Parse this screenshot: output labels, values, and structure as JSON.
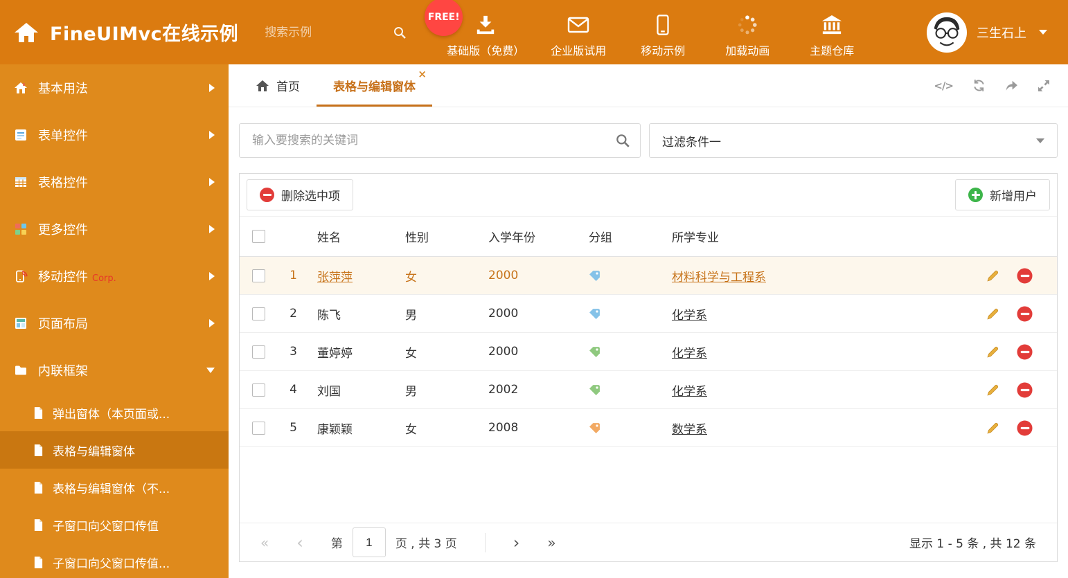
{
  "colors": {
    "header_bg": "#DB7B10",
    "sidebar_bg": "#DF8A1C",
    "sidebar_active_bg": "#C97711",
    "accent": "#C7711A",
    "free_badge_bg": "#FF4642",
    "corp_red": "#E8352A",
    "delete_red": "#E23C39",
    "add_green": "#3DB54A",
    "pencil_orange": "#E8B03C",
    "tag_blue": "#85C2E8",
    "tag_green": "#8FC97F",
    "tag_orange": "#F2A963",
    "selected_row_bg": "#FDF7EC"
  },
  "header": {
    "title": "FineUIMvc在线示例",
    "search_placeholder": "搜索示例",
    "free_badge": "FREE!",
    "nav": [
      {
        "label": "基础版（免费）",
        "icon": "download-icon"
      },
      {
        "label": "企业版试用",
        "icon": "envelope-icon"
      },
      {
        "label": "移动示例",
        "icon": "mobile-icon"
      },
      {
        "label": "加载动画",
        "icon": "spinner-icon"
      },
      {
        "label": "主题仓库",
        "icon": "bank-icon"
      }
    ],
    "user_name": "三生石上"
  },
  "sidebar": {
    "items": [
      {
        "label": "基本用法"
      },
      {
        "label": "表单控件"
      },
      {
        "label": "表格控件"
      },
      {
        "label": "更多控件"
      },
      {
        "label": "移动控件",
        "badge": "Corp."
      },
      {
        "label": "页面布局"
      },
      {
        "label": "内联框架"
      }
    ],
    "subitems": [
      {
        "label": "弹出窗体（本页面或..."
      },
      {
        "label": "表格与编辑窗体"
      },
      {
        "label": "表格与编辑窗体（不..."
      },
      {
        "label": "子窗口向父窗口传值"
      },
      {
        "label": "子窗口向父窗口传值..."
      }
    ]
  },
  "tabs": {
    "home": "首页",
    "active": "表格与编辑窗体"
  },
  "filter": {
    "search_placeholder": "输入要搜索的关键词",
    "dropdown_value": "过滤条件一"
  },
  "grid": {
    "delete_button": "删除选中项",
    "add_button": "新增用户",
    "columns": {
      "name": "姓名",
      "gender": "性别",
      "year": "入学年份",
      "group": "分组",
      "major": "所学专业"
    },
    "rows": [
      {
        "num": "1",
        "name": "张萍萍",
        "gender": "女",
        "year": "2000",
        "tag": "blue",
        "major": "材料科学与工程系"
      },
      {
        "num": "2",
        "name": "陈飞",
        "gender": "男",
        "year": "2000",
        "tag": "blue",
        "major": "化学系"
      },
      {
        "num": "3",
        "name": "董婷婷",
        "gender": "女",
        "year": "2000",
        "tag": "green",
        "major": "化学系"
      },
      {
        "num": "4",
        "name": "刘国",
        "gender": "男",
        "year": "2002",
        "tag": "green",
        "major": "化学系"
      },
      {
        "num": "5",
        "name": "康颖颖",
        "gender": "女",
        "year": "2008",
        "tag": "orange",
        "major": "数学系"
      }
    ]
  },
  "pagination": {
    "page_label_prefix": "第",
    "page_value": "1",
    "page_label_suffix": "页 , 共 3 页",
    "summary": "显示 1 - 5 条 , 共 12 条"
  }
}
